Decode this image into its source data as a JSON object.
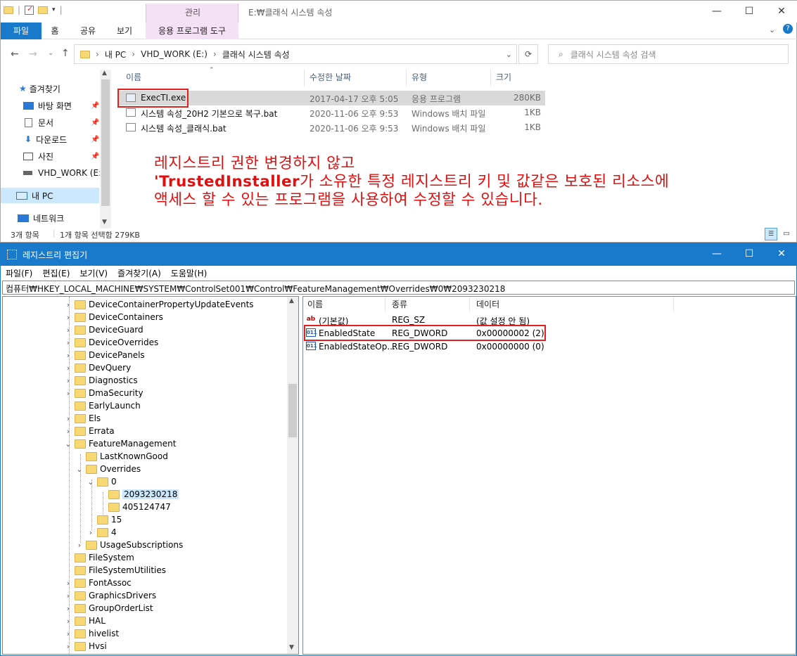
{
  "explorer": {
    "window_title": "E:₩클래식 시스템 속성",
    "context_tab_group": "관리",
    "tabs": [
      "파일",
      "홈",
      "공유",
      "보기",
      "응용 프로그램 도구"
    ],
    "breadcrumb": [
      "내 PC",
      "VHD_WORK (E:)",
      "클래식 시스템 속성"
    ],
    "search_placeholder": "클래식 시스템 속성 검색",
    "nav": {
      "quick_access": "즐겨찾기",
      "items": [
        "바탕 화면",
        "문서",
        "다운로드",
        "사진",
        "VHD_WORK (E:)"
      ],
      "this_pc": "내 PC",
      "network": "네트워크"
    },
    "columns": [
      "이름",
      "수정한 날짜",
      "유형",
      "크기"
    ],
    "files": [
      {
        "name": "ExecTI.exe",
        "date": "2017-04-17 오후 5:05",
        "type": "응용 프로그램",
        "size": "280KB"
      },
      {
        "name": "시스템 속성_20H2 기본으로 복구.bat",
        "date": "2020-11-06 오후 9:53",
        "type": "Windows 배치 파일",
        "size": "1KB"
      },
      {
        "name": "시스템 속성_클래식.bat",
        "date": "2020-11-06 오후 9:53",
        "type": "Windows 배치 파일",
        "size": "1KB"
      }
    ],
    "status_count": "3개 항목",
    "status_selected": "1개 항목 선택함 279KB",
    "annotation": {
      "line1": "레지스트리 권한 변경하지 않고",
      "line2_bold": "'TrustedInstaller",
      "line2_rest": "가 소유한 특정 레지스트리 키 및 값같은 보호된 리소스에",
      "line3": "액세스 할 수 있는 프로그램을 사용하여 수정할 수 있습니다."
    }
  },
  "regedit": {
    "title": "레지스트리 편집기",
    "menu": [
      "파일(F)",
      "편집(E)",
      "보기(V)",
      "즐겨찾기(A)",
      "도움말(H)"
    ],
    "path": "컴퓨터₩HKEY_LOCAL_MACHINE₩SYSTEM₩ControlSet001₩Control₩FeatureManagement₩Overrides₩0₩2093230218",
    "tree": [
      {
        "label": "DeviceContainerPropertyUpdateEvents",
        "level": 0,
        "chevron": "right"
      },
      {
        "label": "DeviceContainers",
        "level": 0,
        "chevron": "right"
      },
      {
        "label": "DeviceGuard",
        "level": 0,
        "chevron": "right"
      },
      {
        "label": "DeviceOverrides",
        "level": 0,
        "chevron": "right"
      },
      {
        "label": "DevicePanels",
        "level": 0,
        "chevron": "right"
      },
      {
        "label": "DevQuery",
        "level": 0,
        "chevron": "right"
      },
      {
        "label": "Diagnostics",
        "level": 0,
        "chevron": "right"
      },
      {
        "label": "DmaSecurity",
        "level": 0,
        "chevron": "right"
      },
      {
        "label": "EarlyLaunch",
        "level": 0,
        "chevron": "none"
      },
      {
        "label": "Els",
        "level": 0,
        "chevron": "right"
      },
      {
        "label": "Errata",
        "level": 0,
        "chevron": "right"
      },
      {
        "label": "FeatureManagement",
        "level": 0,
        "chevron": "down"
      },
      {
        "label": "LastKnownGood",
        "level": 1,
        "chevron": "none"
      },
      {
        "label": "Overrides",
        "level": 1,
        "chevron": "down"
      },
      {
        "label": "0",
        "level": 2,
        "chevron": "down"
      },
      {
        "label": "2093230218",
        "level": 3,
        "chevron": "none",
        "selected": true
      },
      {
        "label": "405124747",
        "level": 3,
        "chevron": "none"
      },
      {
        "label": "15",
        "level": 2,
        "chevron": "none"
      },
      {
        "label": "4",
        "level": 2,
        "chevron": "right"
      },
      {
        "label": "UsageSubscriptions",
        "level": 1,
        "chevron": "right"
      },
      {
        "label": "FileSystem",
        "level": 0,
        "chevron": "none"
      },
      {
        "label": "FileSystemUtilities",
        "level": 0,
        "chevron": "none"
      },
      {
        "label": "FontAssoc",
        "level": 0,
        "chevron": "right"
      },
      {
        "label": "GraphicsDrivers",
        "level": 0,
        "chevron": "right"
      },
      {
        "label": "GroupOrderList",
        "level": 0,
        "chevron": "right"
      },
      {
        "label": "HAL",
        "level": 0,
        "chevron": "right"
      },
      {
        "label": "hivelist",
        "level": 0,
        "chevron": "right"
      },
      {
        "label": "Hvsi",
        "level": 0,
        "chevron": "right"
      }
    ],
    "columns": [
      "이름",
      "종류",
      "데이터"
    ],
    "values": [
      {
        "name": "(기본값)",
        "type": "REG_SZ",
        "data": "(값 설정 안 됨)",
        "icon": "ab"
      },
      {
        "name": "EnabledState",
        "type": "REG_DWORD",
        "data": "0x00000002 (2)",
        "icon": "bin"
      },
      {
        "name": "EnabledStateOp...",
        "type": "REG_DWORD",
        "data": "0x00000000 (0)",
        "icon": "bin"
      }
    ]
  },
  "colors": {
    "accent": "#1979ca",
    "highlight_red": "#e02020",
    "selection": "#cce8ff",
    "folder": "#f8d775"
  }
}
